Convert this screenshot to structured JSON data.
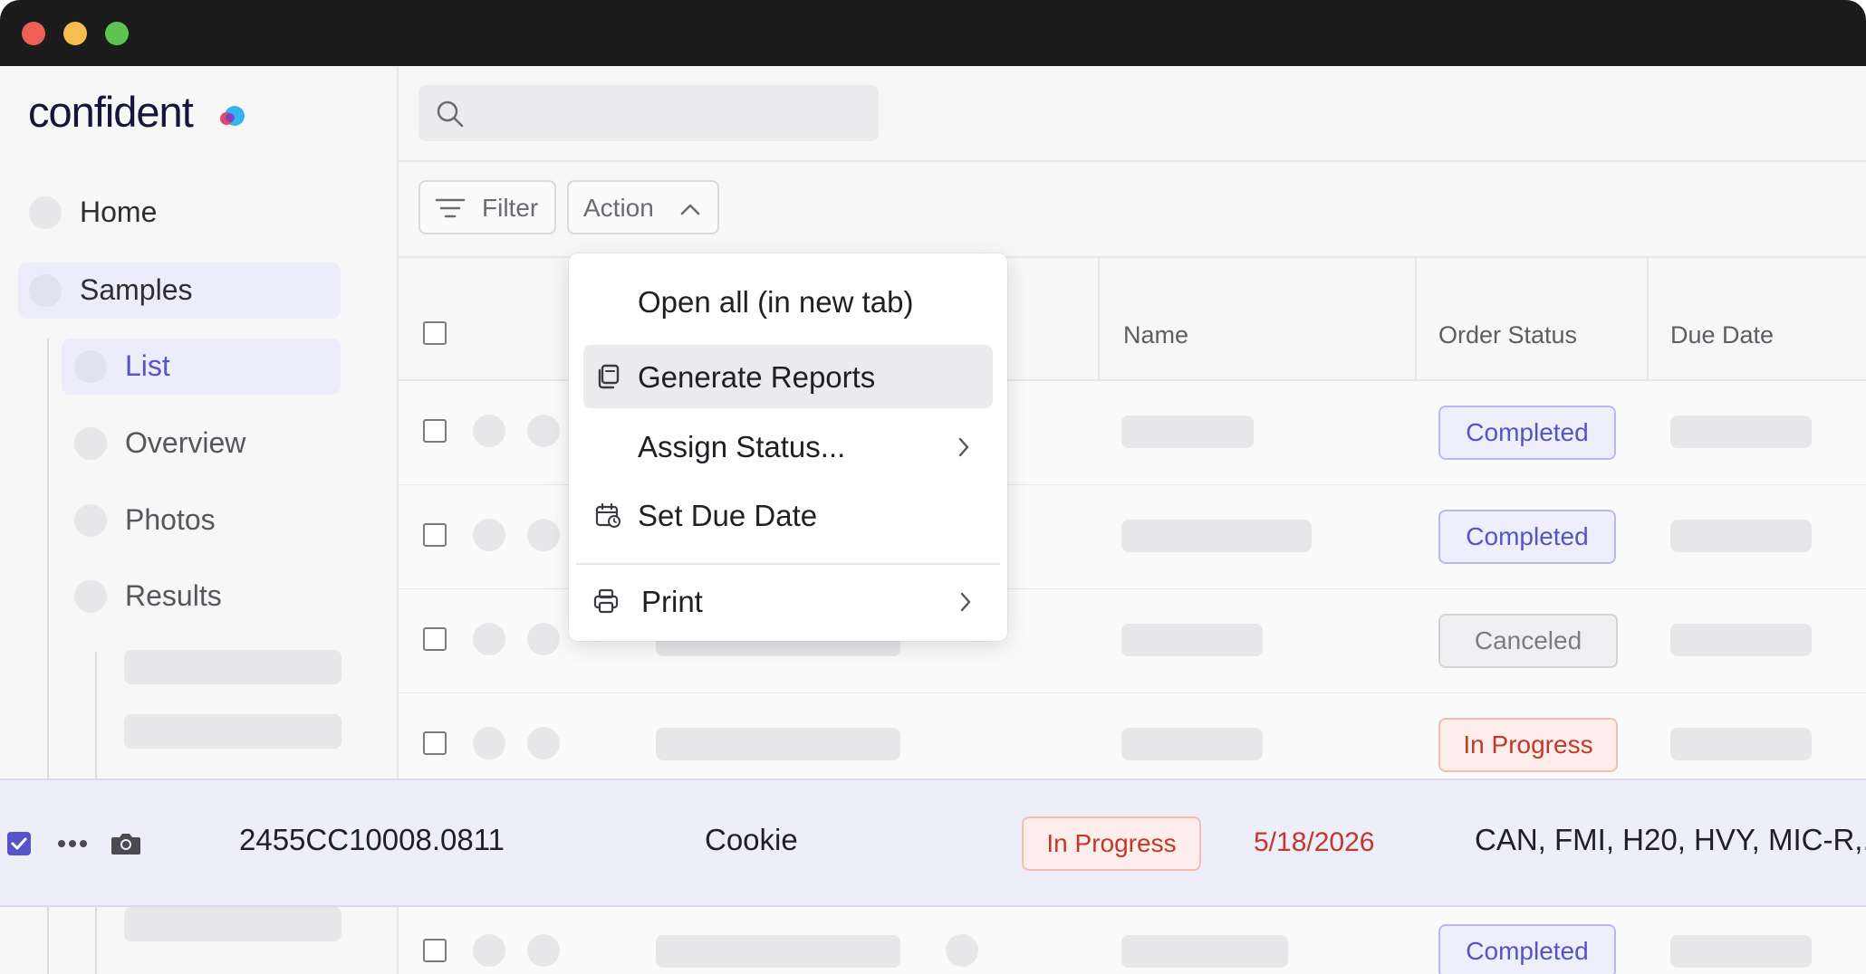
{
  "brand": {
    "logo_text": "confident"
  },
  "sidebar": {
    "items": [
      {
        "label": "Home"
      },
      {
        "label": "Samples"
      },
      {
        "label": "List"
      },
      {
        "label": "Overview"
      },
      {
        "label": "Photos"
      },
      {
        "label": "Results"
      }
    ]
  },
  "toolbar": {
    "filter_label": "Filter",
    "action_label": "Action"
  },
  "action_menu": {
    "items": [
      {
        "label": "Open all (in new tab)"
      },
      {
        "label": "Generate Reports",
        "icon": "copy-icon"
      },
      {
        "label": "Assign Status...",
        "submenu": true
      },
      {
        "label": "Set Due Date",
        "icon": "calendar-icon"
      },
      {
        "label": "Print",
        "icon": "printer-icon",
        "submenu": true
      }
    ]
  },
  "table": {
    "columns": [
      "Name",
      "Order Status",
      "Due Date"
    ],
    "rows": [
      {
        "status": "Completed"
      },
      {
        "status": "Completed"
      },
      {
        "status": "Canceled"
      },
      {
        "status": "In Progress"
      },
      {
        "status": "Completed"
      }
    ]
  },
  "selected_row": {
    "sample_id": "2455CC10008.0811",
    "name": "Cookie",
    "status": "In Progress",
    "due_date": "5/18/2026",
    "tests": "CAN, FMI, H20, HVY, MIC-R,..."
  },
  "colors": {
    "accent": "#5654c8",
    "completed": "#5553c6",
    "in_progress": "#c0392b",
    "canceled": "#7c7c82"
  }
}
